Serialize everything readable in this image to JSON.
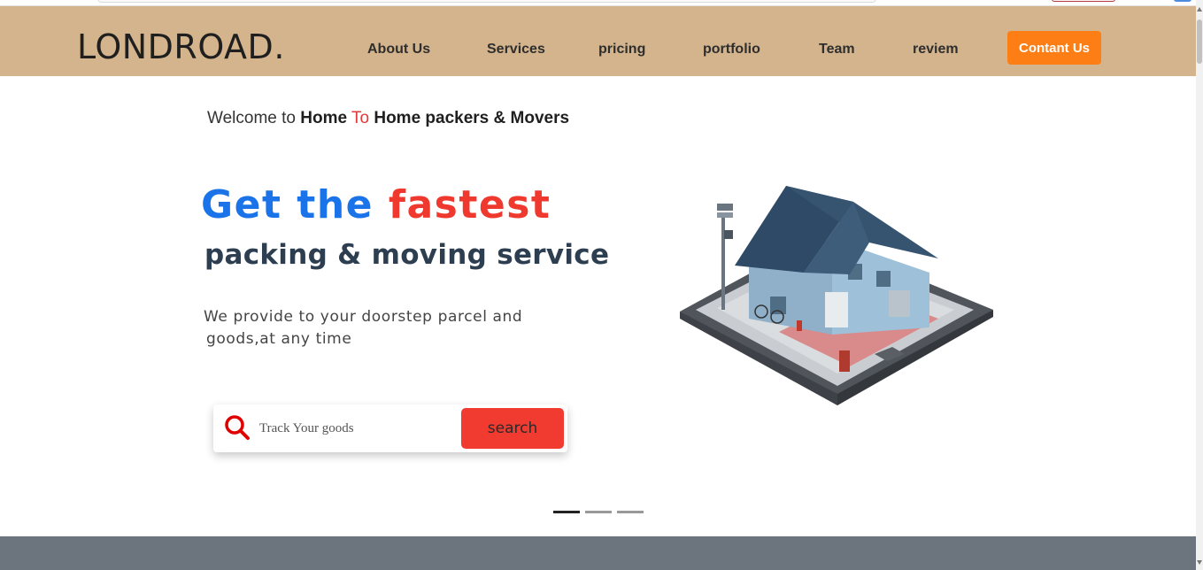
{
  "brand": {
    "logo": "LONDROAD."
  },
  "nav": {
    "items": [
      {
        "label": "About Us"
      },
      {
        "label": "Services"
      },
      {
        "label": "pricing"
      },
      {
        "label": "portfolio"
      },
      {
        "label": "Team"
      },
      {
        "label": "reviem"
      }
    ],
    "contact_label": "Contant Us"
  },
  "hero": {
    "welcome_prefix": "Welcome to",
    "welcome_home1": "Home",
    "welcome_to": "To",
    "welcome_rest": "Home packers & Movers",
    "headline_part1": "Get the",
    "headline_part2": "fastest",
    "subhead": "packing & moving service",
    "desc_line1": "We provide to your doorstep parcel and",
    "desc_line2": "goods,at any time"
  },
  "tracking": {
    "placeholder": "Track Your goods",
    "button_label": "search"
  },
  "carousel": {
    "count": 3,
    "active": 0
  },
  "colors": {
    "navbar": "#d4b48c",
    "accent_orange": "#fd7e14",
    "headline_blue": "#1a73e8",
    "headline_red": "#f0392e",
    "search_red": "#f13a30",
    "footer_band": "#6c757d"
  },
  "icons": [
    "search-icon",
    "house-illustration"
  ]
}
